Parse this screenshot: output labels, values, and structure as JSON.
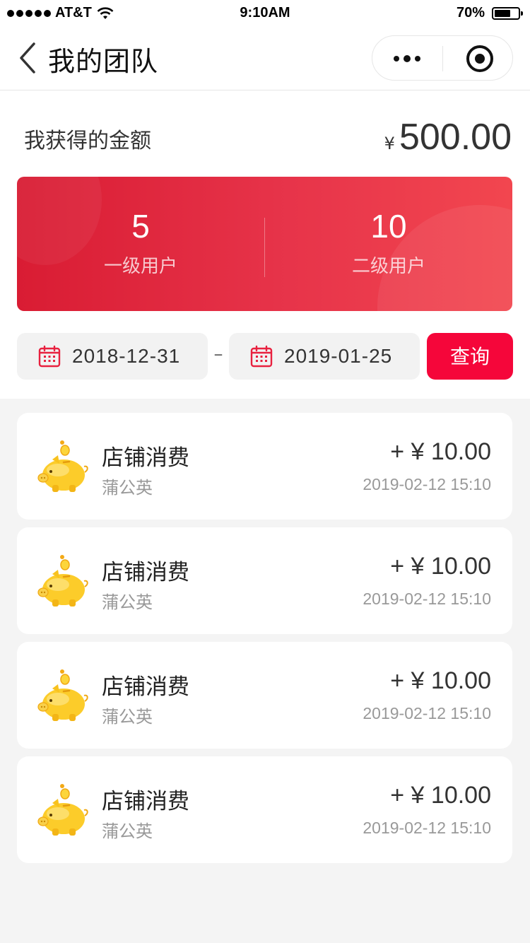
{
  "status_bar": {
    "carrier": "AT&T",
    "time": "9:10AM",
    "battery": "70%",
    "battery_level": 0.7,
    "icons": [
      "signal-dots-icon",
      "wifi-icon",
      "battery-icon"
    ]
  },
  "nav": {
    "title": "我的团队",
    "icons": [
      "back-chevron-icon",
      "more-dots-icon",
      "target-icon"
    ]
  },
  "summary": {
    "label": "我获得的金额",
    "currency": "¥",
    "value": "500.00"
  },
  "stats": [
    {
      "value": "5",
      "label": "一级用户"
    },
    {
      "value": "10",
      "label": "二级用户"
    }
  ],
  "filter": {
    "start_date": "2018-12-31",
    "separator": "–",
    "end_date": "2019-01-25",
    "query_label": "查询"
  },
  "records": [
    {
      "title": "店铺消费",
      "user": "蒲公英",
      "amount": "+ ¥ 10.00",
      "time": "2019-02-12 15:10"
    },
    {
      "title": "店铺消费",
      "user": "蒲公英",
      "amount": "+ ¥ 10.00",
      "time": "2019-02-12 15:10"
    },
    {
      "title": "店铺消费",
      "user": "蒲公英",
      "amount": "+ ¥ 10.00",
      "time": "2019-02-12 15:10"
    },
    {
      "title": "店铺消费",
      "user": "蒲公英",
      "amount": "+ ¥ 10.00",
      "time": "2019-02-12 15:10"
    }
  ],
  "colors": {
    "accent_red": "#f5063a",
    "card_red_start": "#d91c33",
    "card_red_end": "#f2464f",
    "piggy_yellow": "#f8c21e"
  }
}
